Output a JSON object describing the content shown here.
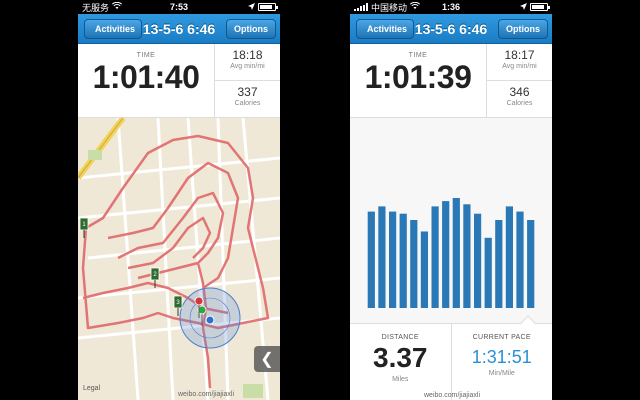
{
  "left": {
    "status": {
      "carrier": "无服务",
      "time": "7:53"
    },
    "nav": {
      "back_label": "Activities",
      "title": "13-5-6 6:46",
      "options_label": "Options"
    },
    "stats": {
      "time_label": "TIME",
      "time_value": "1:01:40",
      "pace_value": "18:18",
      "pace_unit": "Avg min/mi",
      "calories_value": "337",
      "calories_unit": "Calories"
    },
    "map": {
      "legal": "Legal",
      "mile_markers": [
        "1",
        "2",
        "3"
      ],
      "watermark": "weibo.com/jiajiaxli"
    }
  },
  "right": {
    "status": {
      "carrier": "中国移动",
      "time": "1:36"
    },
    "nav": {
      "back_label": "Activities",
      "title": "13-5-6 6:46",
      "options_label": "Options"
    },
    "stats": {
      "time_label": "TIME",
      "time_value": "1:01:39",
      "pace_value": "18:17",
      "pace_unit": "Avg min/mi",
      "calories_value": "346",
      "calories_unit": "Calories"
    },
    "bottom": {
      "distance_label": "DISTANCE",
      "distance_value": "3.37",
      "distance_unit": "Miles",
      "pace_label": "CURRENT PACE",
      "pace_value": "1:31:51",
      "pace_unit": "Min/Mile"
    },
    "watermark": "weibo.com/jiajiaxli"
  },
  "colors": {
    "accent": "#1a7cc4",
    "bar": "#2a78b5",
    "route": "#e0686a",
    "pace": "#2b8fd6"
  },
  "chart_data": {
    "type": "bar",
    "title": "",
    "xlabel": "",
    "ylabel": "",
    "values": [
      92,
      97,
      92,
      90,
      84,
      73,
      97,
      102,
      105,
      99,
      90,
      67,
      84,
      97,
      92,
      84
    ]
  }
}
